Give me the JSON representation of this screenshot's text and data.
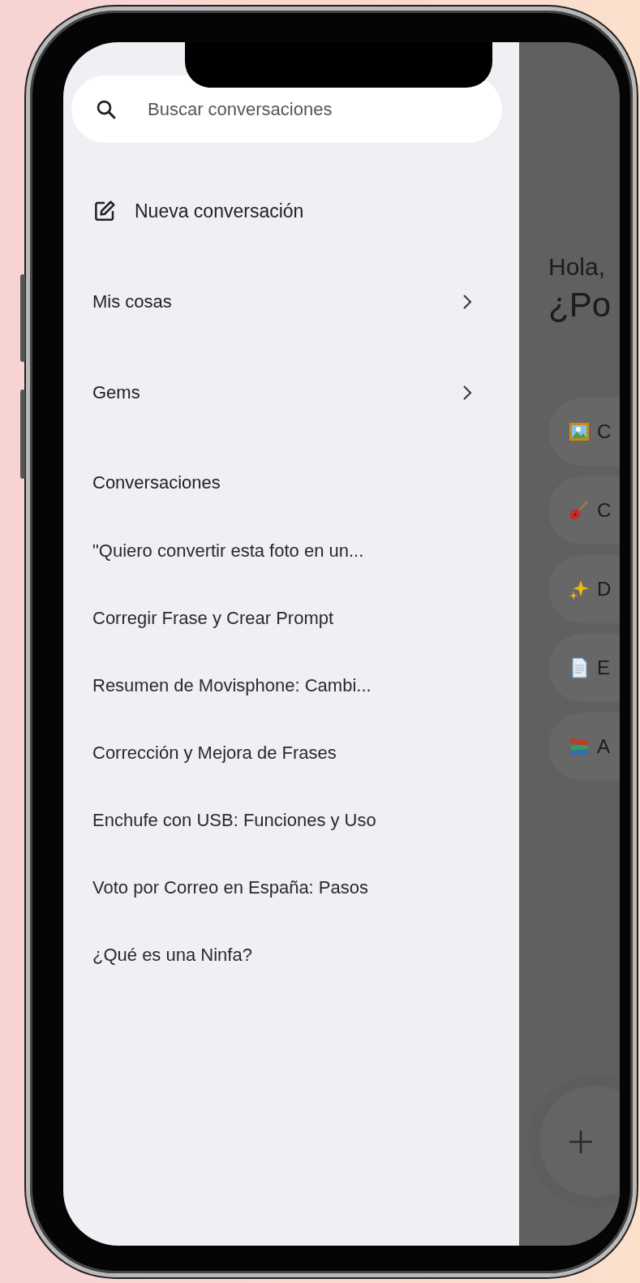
{
  "search": {
    "placeholder": "Buscar conversaciones"
  },
  "new_chat": {
    "label": "Nueva conversación"
  },
  "menu": [
    {
      "label": "Mis cosas"
    },
    {
      "label": "Gems"
    }
  ],
  "section_title": "Conversaciones",
  "conversations": [
    {
      "title": "\"Quiero convertir esta foto en un..."
    },
    {
      "title": "Corregir Frase y Crear Prompt"
    },
    {
      "title": "Resumen de Movisphone: Cambi..."
    },
    {
      "title": "Corrección y Mejora de Frases"
    },
    {
      "title": "Enchufe con USB: Funciones y Uso"
    },
    {
      "title": "Voto por Correo en España: Pasos"
    },
    {
      "title": "¿Qué es una Ninfa?"
    }
  ],
  "main": {
    "greeting": "Hola,",
    "headline": "¿Po",
    "chips": [
      {
        "kind": "picture",
        "label": "C"
      },
      {
        "kind": "guitar",
        "label": "C"
      },
      {
        "kind": "sparkles",
        "label": "D"
      },
      {
        "kind": "document",
        "label": "E"
      },
      {
        "kind": "books",
        "label": "A"
      }
    ]
  }
}
